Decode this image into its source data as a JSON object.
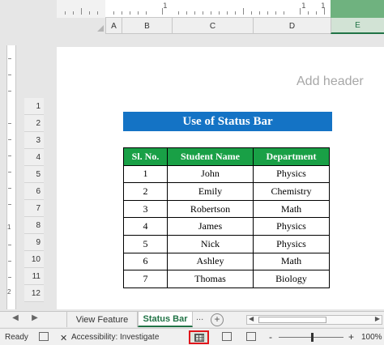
{
  "ruler": {
    "marks": [
      "1",
      "1",
      "1"
    ]
  },
  "columns": [
    "A",
    "B",
    "C",
    "D",
    "E"
  ],
  "rows": [
    "1",
    "2",
    "3",
    "4",
    "5",
    "6",
    "7",
    "8",
    "9",
    "10",
    "11",
    "12"
  ],
  "vruler_marks": [
    "1",
    "2"
  ],
  "page": {
    "add_header": "Add header",
    "title": "Use of Status Bar",
    "table": {
      "headers": [
        "Sl. No.",
        "Student Name",
        "Department"
      ],
      "rows": [
        [
          "1",
          "John",
          "Physics"
        ],
        [
          "2",
          "Emily",
          "Chemistry"
        ],
        [
          "3",
          "Robertson",
          "Math"
        ],
        [
          "4",
          "James",
          "Physics"
        ],
        [
          "5",
          "Nick",
          "Physics"
        ],
        [
          "6",
          "Ashley",
          "Math"
        ],
        [
          "7",
          "Thomas",
          "Biology"
        ]
      ]
    }
  },
  "sheet_tabs": {
    "prev": "◀",
    "next": "▶",
    "tabs": [
      "View Feature",
      "Status Bar"
    ],
    "active_index": 1,
    "more": "...",
    "add": "+"
  },
  "status_bar": {
    "ready": "Ready",
    "accessibility": "Accessibility: Investigate",
    "zoom_minus": "-",
    "zoom_plus": "+",
    "zoom_level": "100%"
  },
  "colors": {
    "title_bg": "#1473c5",
    "header_bg": "#19a046",
    "accent": "#217346",
    "highlight": "#e0151b"
  }
}
